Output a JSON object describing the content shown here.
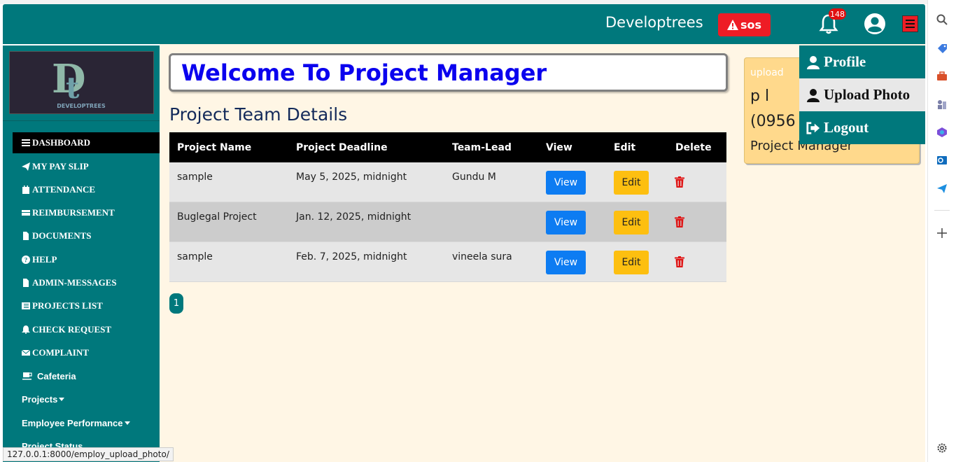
{
  "app": {
    "brand": "Developtrees",
    "sos_label": "sos",
    "notification_count": "148"
  },
  "sidebar": {
    "logo_text": "DEVELOPTREES",
    "items": [
      {
        "label": "DASHBOARD",
        "icon": "bars-icon"
      },
      {
        "label": "MY PAY SLIP",
        "icon": "paper-plane-icon"
      },
      {
        "label": "ATTENDANCE",
        "icon": "calendar-icon"
      },
      {
        "label": "REIMBURSEMENT",
        "icon": "credit-card-icon"
      },
      {
        "label": "DOCUMENTS",
        "icon": "file-icon"
      },
      {
        "label": "HELP",
        "icon": "question-circle-icon"
      },
      {
        "label": "ADMIN-MESSAGES",
        "icon": "file-icon"
      },
      {
        "label": "PROJECTS LIST",
        "icon": "list-icon"
      },
      {
        "label": "CHECK REQUEST",
        "icon": "bell-icon"
      },
      {
        "label": "COMPLAINT",
        "icon": "envelope-icon"
      },
      {
        "label": "Cafeteria",
        "icon": "coffee-icon"
      },
      {
        "label": "Projects",
        "icon": "caret-down-icon"
      },
      {
        "label": "Employee Performance",
        "icon": "caret-down-icon"
      },
      {
        "label": "Project Status",
        "icon": ""
      }
    ]
  },
  "main": {
    "welcome": "Welcome To Project Manager",
    "section_title": "Project Team Details",
    "table": {
      "headers": [
        "Project Name",
        "Project Deadline",
        "Team-Lead",
        "View",
        "Edit",
        "Delete"
      ],
      "rows": [
        {
          "name": "sample",
          "deadline": "May 5, 2025, midnight",
          "lead": "Gundu M",
          "view": "View",
          "edit": "Edit"
        },
        {
          "name": "Buglegal Project",
          "deadline": "Jan. 12, 2025, midnight",
          "lead": "",
          "view": "View",
          "edit": "Edit"
        },
        {
          "name": "sample",
          "deadline": "Feb. 7, 2025, midnight",
          "lead": "vineela sura",
          "view": "View",
          "edit": "Edit"
        }
      ]
    },
    "page_number": "1"
  },
  "profile_card": {
    "image_alt": "upload",
    "name": "p l",
    "phone": "(0956",
    "role": "Project Manager"
  },
  "dropdown": {
    "items": [
      "Profile",
      "Upload Photo",
      "Logout"
    ]
  },
  "status_bar": {
    "url": "127.0.0.1:8000/employ_upload_photo/"
  },
  "colors": {
    "teal": "#00787c",
    "sos_red": "#ee1c25",
    "view_blue": "#0d7cf2",
    "edit_yellow": "#fdbf10",
    "welcome_blue": "#0a00ee",
    "content_bg": "#fff6e5",
    "card_bg": "#ffd98c"
  }
}
